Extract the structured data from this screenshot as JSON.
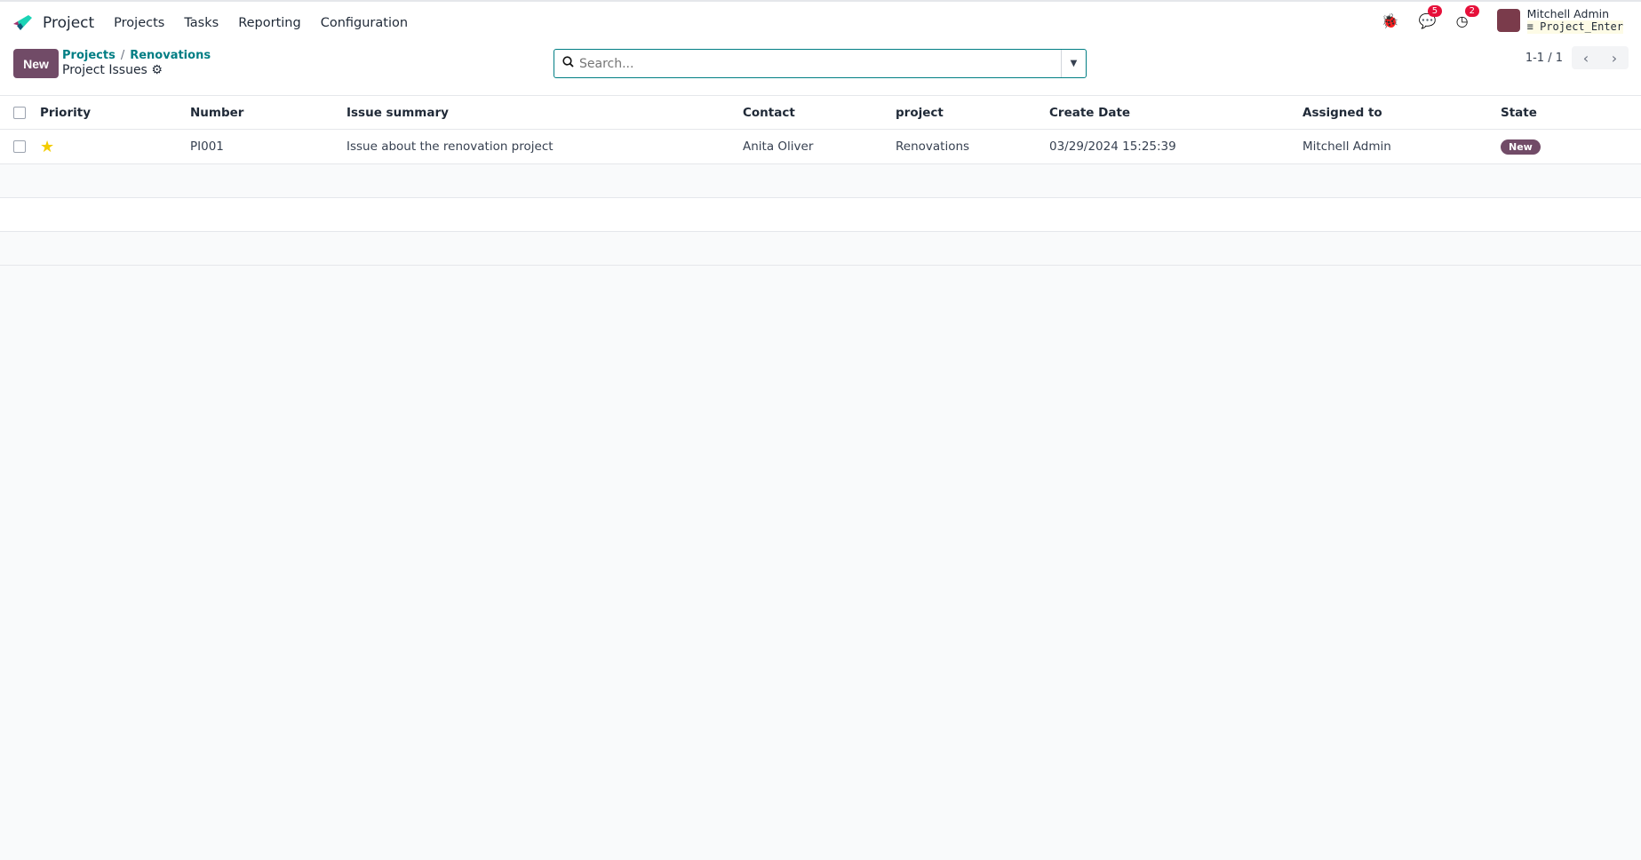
{
  "nav": {
    "app": "Project",
    "menu": [
      "Projects",
      "Tasks",
      "Reporting",
      "Configuration"
    ],
    "messages_count": "5",
    "activities_count": "2",
    "user_name": "Mitchell Admin",
    "database": "Project_Enter"
  },
  "control": {
    "new_label": "New",
    "breadcrumb": [
      "Projects",
      "Renovations"
    ],
    "breadcrumb_sep": "/",
    "title": "Project Issues",
    "search_placeholder": "Search...",
    "pager": "1-1 / 1"
  },
  "table": {
    "headers": [
      "Priority",
      "Number",
      "Issue summary",
      "Contact",
      "project",
      "Create Date",
      "Assigned to",
      "State"
    ],
    "rows": [
      {
        "priority": "1",
        "number": "PI001",
        "summary": "Issue about the renovation project",
        "contact": "Anita Oliver",
        "project": "Renovations",
        "create_date": "03/29/2024 15:25:39",
        "assigned": "Mitchell Admin",
        "state": "New"
      }
    ]
  },
  "colors": {
    "brand": "#714b67",
    "link": "#017e84",
    "badge": "#e6103a",
    "star": "#f3cc00"
  }
}
